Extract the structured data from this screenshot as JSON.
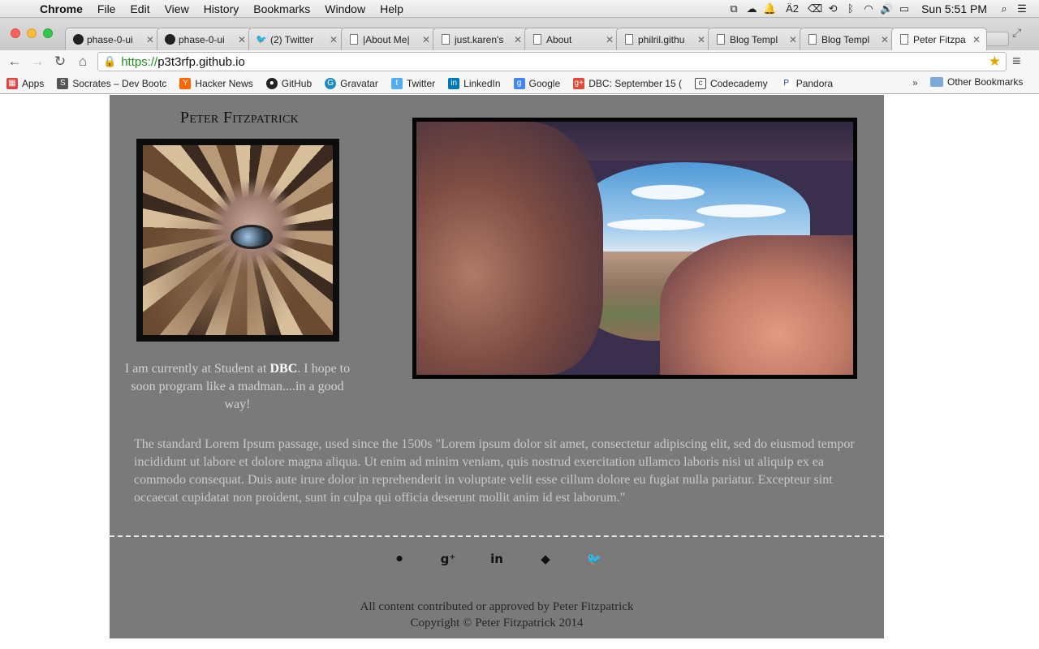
{
  "menubar": {
    "app": "Chrome",
    "items": [
      "File",
      "Edit",
      "View",
      "History",
      "Bookmarks",
      "Window",
      "Help"
    ],
    "status_icons": [
      "window-icon",
      "creative-cloud-icon",
      "bell-icon",
      "adobe-icon",
      "cleanup-icon",
      "time-machine-icon",
      "bluetooth-icon",
      "wifi-icon",
      "volume-icon",
      "battery-icon"
    ],
    "adobe_count": "2",
    "clock": "Sun 5:51 PM"
  },
  "tabs": [
    {
      "label": "phase-0-ui",
      "icon": "github-icon"
    },
    {
      "label": "phase-0-ui",
      "icon": "github-icon"
    },
    {
      "label": "(2) Twitter",
      "icon": "twitter-icon"
    },
    {
      "label": "|About Me|",
      "icon": "document-icon"
    },
    {
      "label": "just.karen's",
      "icon": "document-icon"
    },
    {
      "label": "About",
      "icon": "document-icon"
    },
    {
      "label": "philril.githu",
      "icon": "document-icon"
    },
    {
      "label": "Blog Templ",
      "icon": "document-icon"
    },
    {
      "label": "Blog Templ",
      "icon": "document-icon"
    },
    {
      "label": "Peter Fitzpa",
      "icon": "document-icon",
      "active": true
    }
  ],
  "omnibox": {
    "scheme": "https://",
    "host": "p3t3rfp.github.io"
  },
  "bookmarks": [
    {
      "label": "Apps",
      "icon": "apps-grid-icon",
      "color": "#d44"
    },
    {
      "label": "Socrates – Dev Bootc",
      "icon": "socrates-icon",
      "color": "#555"
    },
    {
      "label": "Hacker News",
      "icon": "hacker-news-icon",
      "color": "#ff6600"
    },
    {
      "label": "GitHub",
      "icon": "github-icon",
      "color": "#222"
    },
    {
      "label": "Gravatar",
      "icon": "gravatar-icon",
      "color": "#1e8cbe"
    },
    {
      "label": "Twitter",
      "icon": "twitter-icon",
      "color": "#55acee"
    },
    {
      "label": "LinkedIn",
      "icon": "linkedin-icon",
      "color": "#0077b5"
    },
    {
      "label": "Google",
      "icon": "google-icon",
      "color": "#4285f4"
    },
    {
      "label": "DBC: September 15 (",
      "icon": "google-plus-icon",
      "color": "#dd4b39"
    },
    {
      "label": "Codecademy",
      "icon": "codecademy-icon",
      "color": "#444"
    },
    {
      "label": "Pandora",
      "icon": "pandora-icon",
      "color": "#224099"
    }
  ],
  "bookmarks_more": "»",
  "bookmarks_other": "Other Bookmarks",
  "page": {
    "name": "Peter Fitzpatrick",
    "intro_prefix": "I am currently at Student at ",
    "intro_bold": "DBC",
    "intro_suffix": ". I hope to soon program like a madman....in a good way!",
    "lorem": "The standard Lorem Ipsum passage, used since the 1500s \"Lorem ipsum dolor sit amet, consectetur adipiscing elit, sed do eiusmod tempor incididunt ut labore et dolore magna aliqua. Ut enim ad minim veniam, quis nostrud exercitation ullamco laboris nisi ut aliquip ex ea commodo consequat. Duis aute irure dolor in reprehenderit in voluptate velit esse cillum dolore eu fugiat nulla pariatur. Excepteur sint occaecat cupidatat non proident, sunt in culpa qui officia deserunt mollit anim id est laborum.\"",
    "socials": [
      {
        "name": "github-icon",
        "glyph": "⚫"
      },
      {
        "name": "google-plus-icon",
        "glyph": "g⁺"
      },
      {
        "name": "linkedin-icon",
        "glyph": "in"
      },
      {
        "name": "evernote-icon",
        "glyph": "◆"
      },
      {
        "name": "twitter-icon",
        "glyph": "🐦"
      }
    ],
    "footer_line1": "All content contributed or approved by Peter Fitzpatrick",
    "footer_line2": "Copyright © Peter Fitzpatrick 2014"
  }
}
